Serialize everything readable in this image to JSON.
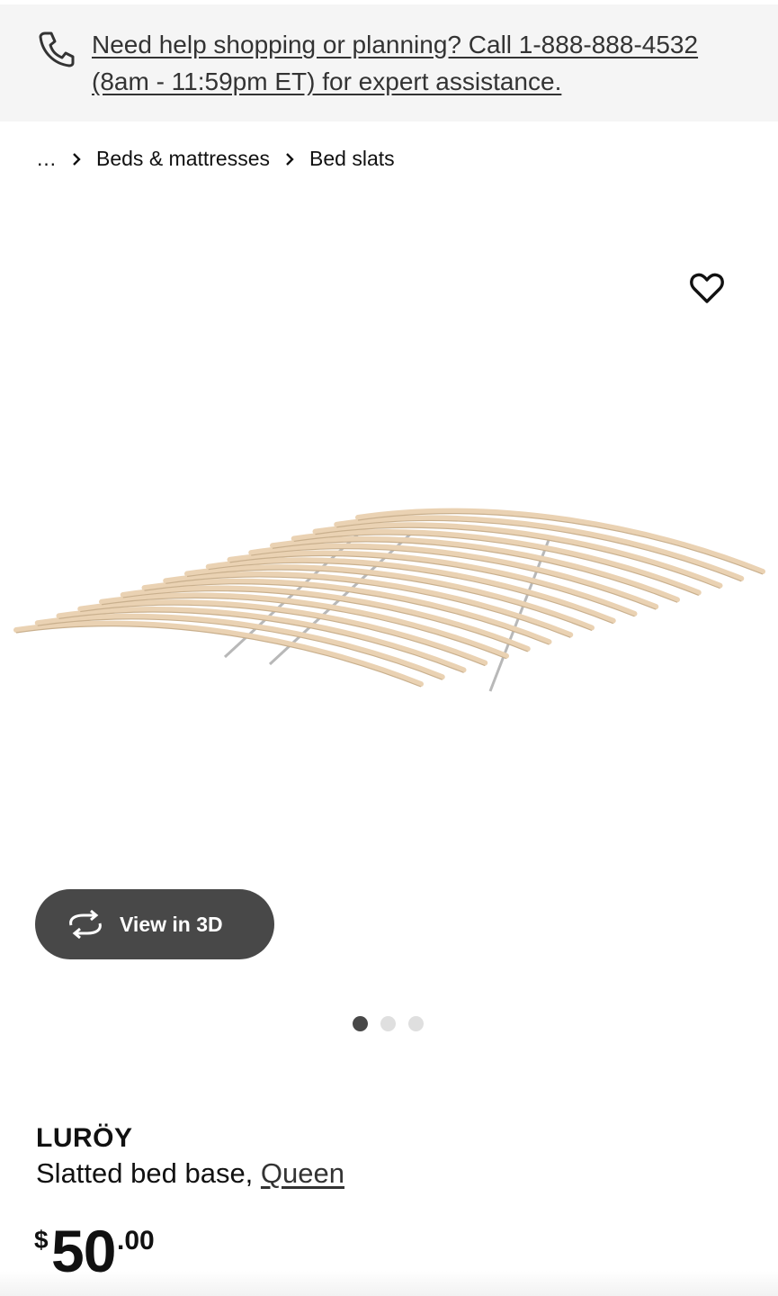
{
  "help_banner": {
    "text": "Need help shopping or planning? Call 1-888-888-4532 (8am - 11:59pm ET) for expert assistance."
  },
  "breadcrumb": {
    "items": [
      "…",
      "Beds & mattresses",
      "Bed slats"
    ]
  },
  "gallery": {
    "view_3d_label": "View in 3D",
    "slide_count": 3,
    "active_slide": 1
  },
  "product": {
    "name": "LURÖY",
    "description": "Slatted bed base,",
    "variant": "Queen"
  },
  "price": {
    "currency": "$",
    "integer": "50",
    "decimal": ".00"
  },
  "colors": {
    "banner_bg": "#f5f5f5",
    "button_bg": "#484848",
    "slat_wood": "#ead2b3"
  }
}
